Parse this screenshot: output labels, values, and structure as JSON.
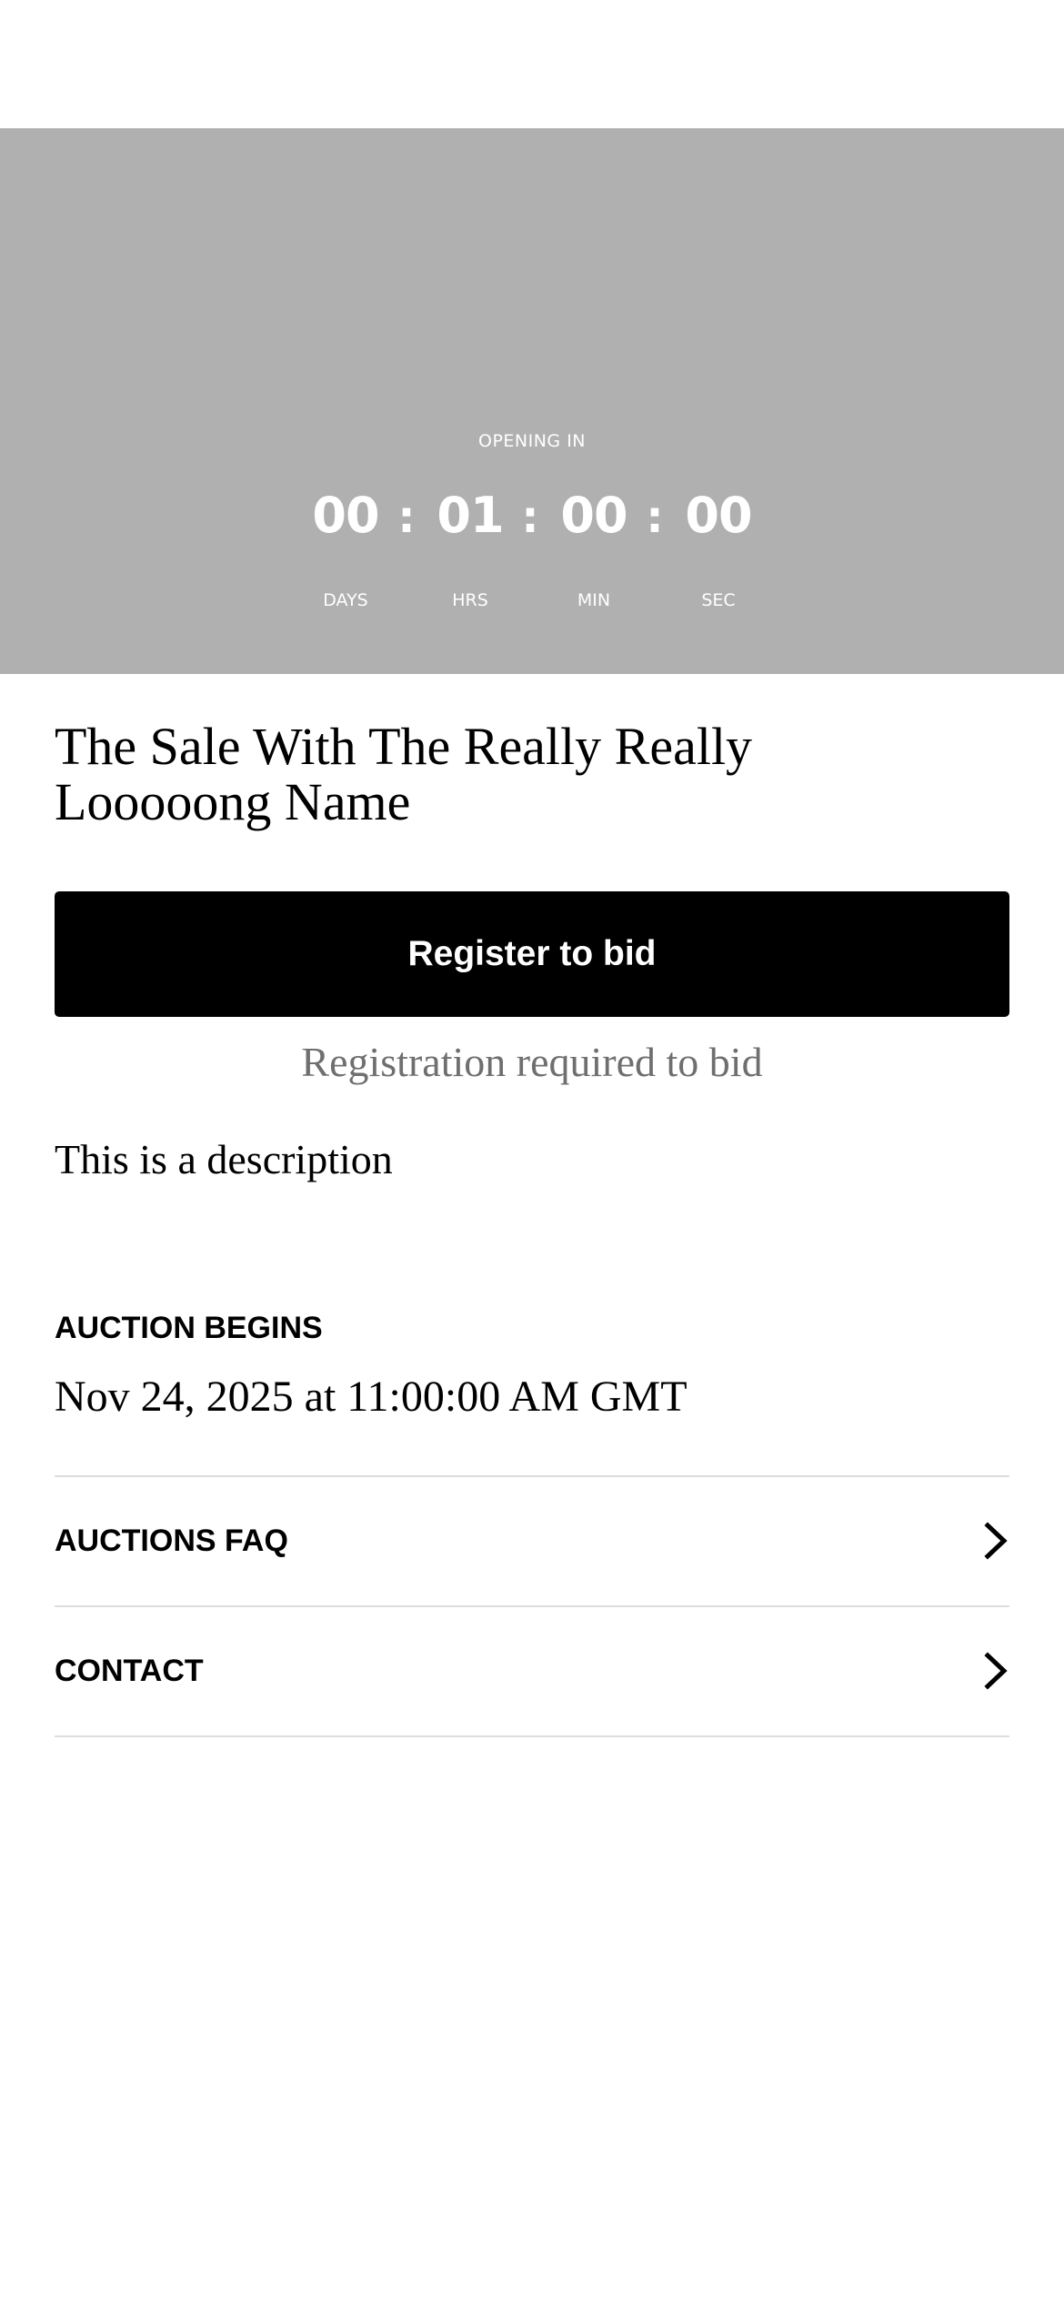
{
  "hero": {
    "opening_label": "OPENING IN",
    "countdown": {
      "days": "00",
      "hours": "01",
      "minutes": "00",
      "seconds": "00",
      "days_label": "DAYS",
      "hours_label": "HRS",
      "minutes_label": "MIN",
      "seconds_label": "SEC",
      "separator": ":"
    },
    "background_color": "#b0b0b0"
  },
  "sale": {
    "title": "The Sale With The Really Really Looooong Name",
    "register_label": "Register to bid",
    "registration_note": "Registration required to bid",
    "description": "This is a description"
  },
  "auction": {
    "begins_label": "AUCTION BEGINS",
    "begins_value": "Nov 24, 2025 at 11:00:00 AM GMT"
  },
  "links": [
    {
      "label": "AUCTIONS FAQ",
      "icon": "chevron-right-icon"
    },
    {
      "label": "CONTACT",
      "icon": "chevron-right-icon"
    }
  ],
  "colors": {
    "primary_button": "#000000",
    "muted_text": "#6f6f6f",
    "divider": "#dddddd"
  }
}
